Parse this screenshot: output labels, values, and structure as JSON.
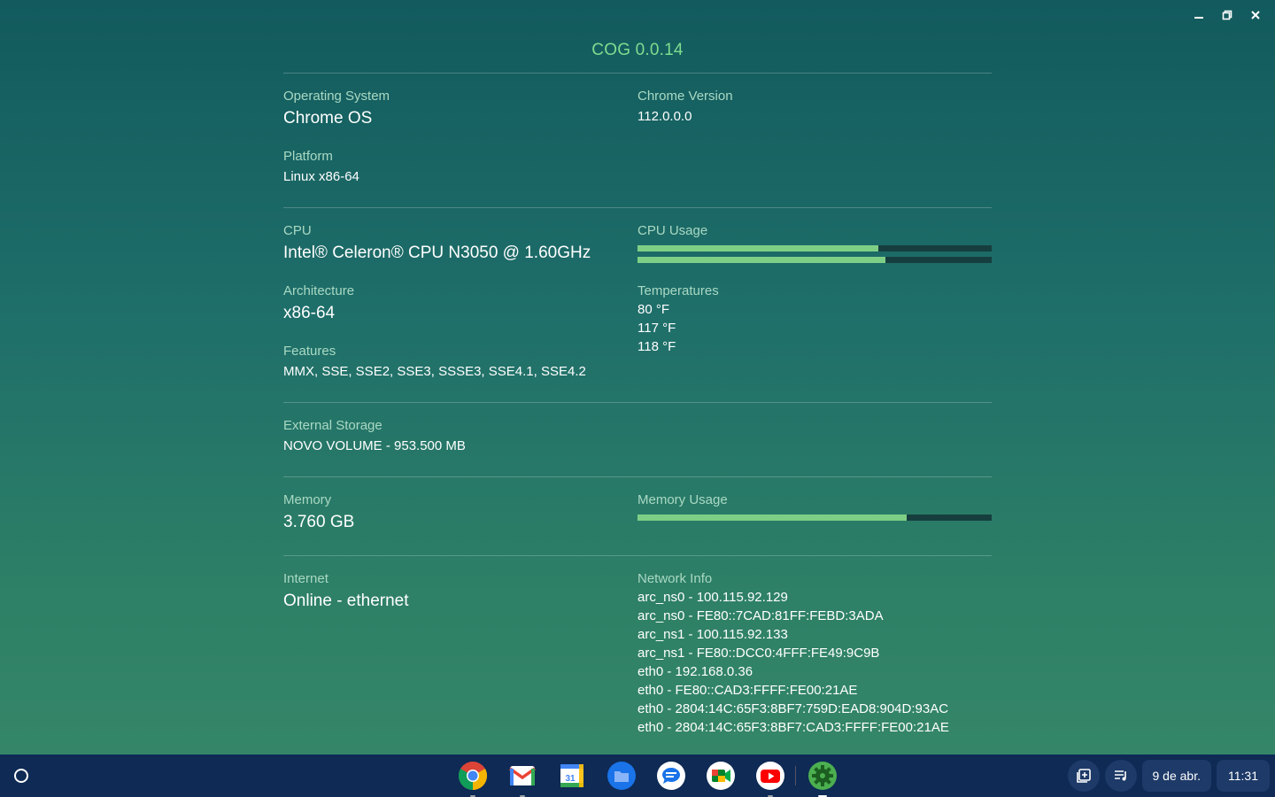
{
  "app": {
    "title": "COG 0.0.14"
  },
  "window_controls": [
    "minimize-icon",
    "restore-icon",
    "close-icon"
  ],
  "system": {
    "os_label": "Operating System",
    "os_value": "Chrome OS",
    "chrome_label": "Chrome Version",
    "chrome_value": "112.0.0.0",
    "platform_label": "Platform",
    "platform_value": "Linux x86-64"
  },
  "cpu": {
    "label": "CPU",
    "value": "Intel® Celeron® CPU N3050 @ 1.60GHz",
    "arch_label": "Architecture",
    "arch_value": "x86-64",
    "features_label": "Features",
    "features_value": "MMX, SSE, SSE2, SSE3, SSSE3, SSE4.1, SSE4.2",
    "usage_label": "CPU Usage",
    "usage_fractions": [
      0.68,
      0.7
    ],
    "temps_label": "Temperatures",
    "temps": [
      "80 °F",
      "117 °F",
      "118 °F"
    ]
  },
  "storage": {
    "label": "External Storage",
    "value": "NOVO VOLUME - 953.500 MB"
  },
  "memory": {
    "label": "Memory",
    "value": "3.760 GB",
    "usage_label": "Memory Usage",
    "usage_fraction": 0.76
  },
  "network": {
    "internet_label": "Internet",
    "internet_value": "Online - ethernet",
    "info_label": "Network Info",
    "lines": [
      "arc_ns0 - 100.115.92.129",
      "arc_ns0 - FE80::7CAD:81FF:FEBD:3ADA",
      "arc_ns1 - 100.115.92.133",
      "arc_ns1 - FE80::DCC0:4FFF:FE49:9C9B",
      "eth0 - 192.168.0.36",
      "eth0 - FE80::CAD3:FFFF:FE00:21AE",
      "eth0 - 2804:14C:65F3:8BF7:759D:EAD8:904D:93AC",
      "eth0 - 2804:14C:65F3:8BF7:CAD3:FFFF:FE00:21AE"
    ]
  },
  "colors": {
    "accent": "#7fdc8f",
    "bar_fill": "#7ecf86",
    "bar_track": "#163e3e",
    "taskbar": "#0e2a55"
  },
  "taskbar": {
    "apps": [
      "chrome-icon",
      "gmail-icon",
      "calendar-icon",
      "files-icon",
      "messages-icon",
      "meet-icon",
      "youtube-icon",
      "cog-icon"
    ],
    "date": "9 de abr.",
    "time": "11:31"
  }
}
